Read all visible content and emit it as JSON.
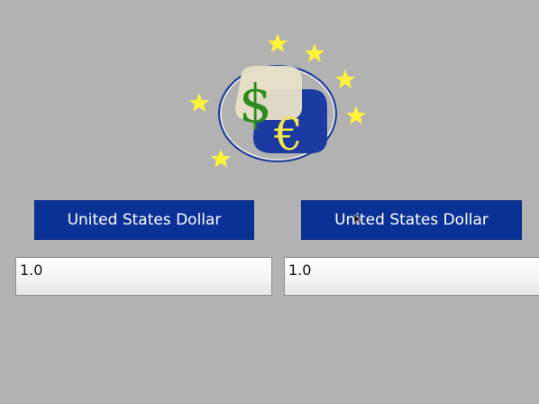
{
  "converter": {
    "from_currency": "United States Dollar",
    "to_currency": "United States Dollar",
    "from_amount": "1.0",
    "to_amount": "1.0"
  },
  "logo": {
    "glyph_dollar": "$",
    "glyph_euro": "€",
    "icon": "currency-converter-logo"
  },
  "colors": {
    "background": "#b2b2b2",
    "button": "#0a3296",
    "button_text": "#ffffff",
    "star": "#fff23a",
    "dollar": "#2e8b1e",
    "euro": "#f2e64a",
    "logo_ring": "#1c3c9c"
  }
}
